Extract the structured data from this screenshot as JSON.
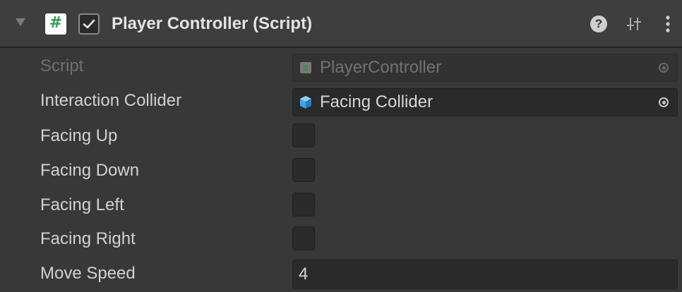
{
  "component": {
    "title": "Player Controller (Script)",
    "enabled": true,
    "icons": {
      "foldout": "foldout-arrow-icon",
      "script": "csharp-script-icon",
      "help": "help-icon",
      "presets": "presets-icon",
      "more": "kebab-menu-icon"
    },
    "accent_colors": {
      "script_icon_hash": "#2f9e55",
      "gameobject_cube": "#3fa7e8"
    }
  },
  "fields": {
    "script": {
      "label": "Script",
      "value": "PlayerController"
    },
    "interaction_collider": {
      "label": "Interaction Collider",
      "value": "Facing Collider"
    },
    "facing_up": {
      "label": "Facing Up",
      "checked": false
    },
    "facing_down": {
      "label": "Facing Down",
      "checked": false
    },
    "facing_left": {
      "label": "Facing Left",
      "checked": false
    },
    "facing_right": {
      "label": "Facing Right",
      "checked": false
    },
    "move_speed": {
      "label": "Move Speed",
      "value": "4"
    }
  }
}
